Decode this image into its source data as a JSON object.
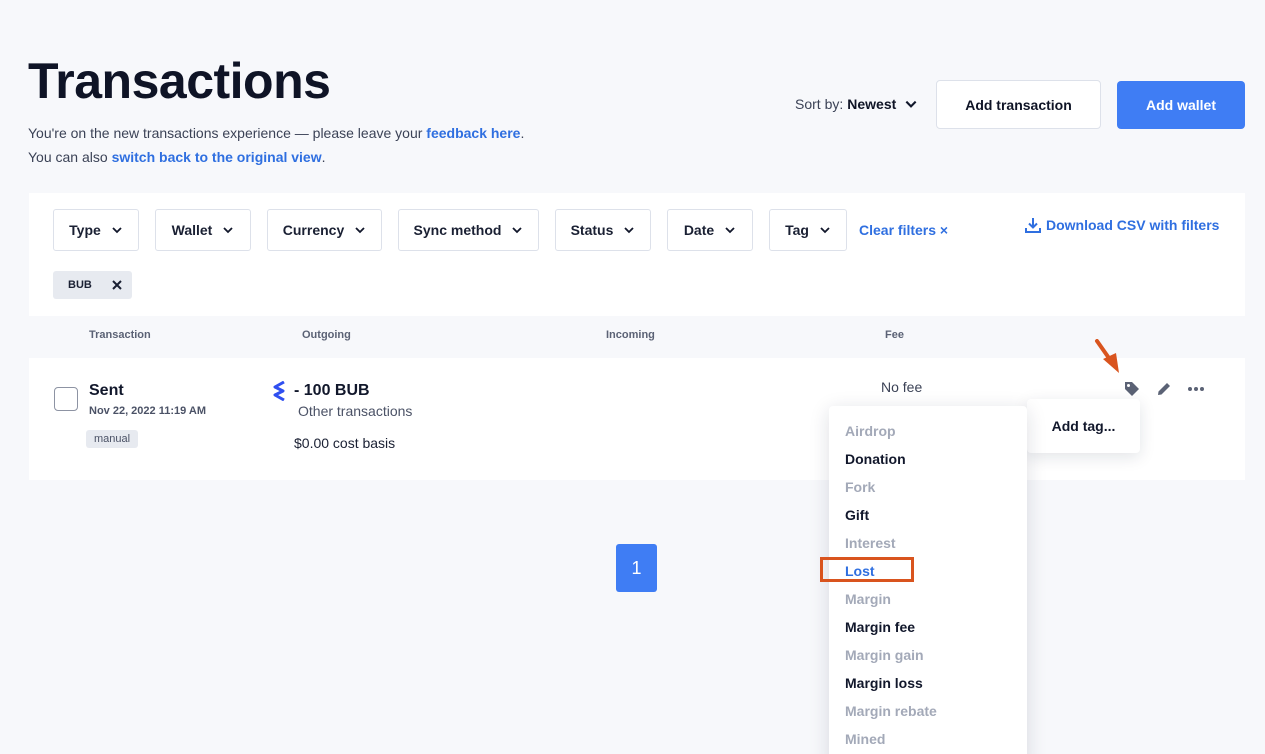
{
  "header": {
    "title": "Transactions",
    "notice_line1_prefix": "You're on the new transactions experience — please leave your ",
    "notice_line1_link": "feedback here",
    "notice_line1_suffix": ".",
    "notice_line2_prefix": "You can also ",
    "notice_line2_link": "switch back to the original view",
    "notice_line2_suffix": ".",
    "sort_label": "Sort by:",
    "sort_value": "Newest",
    "add_transaction": "Add transaction",
    "add_wallet": "Add wallet"
  },
  "filters": {
    "items": [
      "Type",
      "Wallet",
      "Currency",
      "Sync method",
      "Status",
      "Date",
      "Tag"
    ],
    "clear_label": "Clear filters ×",
    "download_label": "Download CSV with filters",
    "chip_label": "BUB"
  },
  "table": {
    "columns": [
      "Transaction",
      "Outgoing",
      "Incoming",
      "Fee"
    ]
  },
  "row": {
    "type": "Sent",
    "date": "Nov 22, 2022 11:19 AM",
    "badge": "manual",
    "amount": "- 100 BUB",
    "category": "Other transactions",
    "cost_basis": "$0.00 cost basis",
    "fee": "No fee"
  },
  "tooltip": {
    "label": "Add tag..."
  },
  "pagination": {
    "current": "1"
  },
  "tag_menu": {
    "items": [
      {
        "label": "Airdrop",
        "state": "muted"
      },
      {
        "label": "Donation",
        "state": "active"
      },
      {
        "label": "Fork",
        "state": "muted"
      },
      {
        "label": "Gift",
        "state": "active"
      },
      {
        "label": "Interest",
        "state": "muted"
      },
      {
        "label": "Lost",
        "state": "selected"
      },
      {
        "label": "Margin",
        "state": "muted"
      },
      {
        "label": "Margin fee",
        "state": "active"
      },
      {
        "label": "Margin gain",
        "state": "muted"
      },
      {
        "label": "Margin loss",
        "state": "active"
      },
      {
        "label": "Margin rebate",
        "state": "muted"
      },
      {
        "label": "Mined",
        "state": "muted"
      }
    ]
  },
  "colors": {
    "accent": "#3f7df4",
    "link": "#2f6fe0",
    "annotation": "#d9541e"
  }
}
